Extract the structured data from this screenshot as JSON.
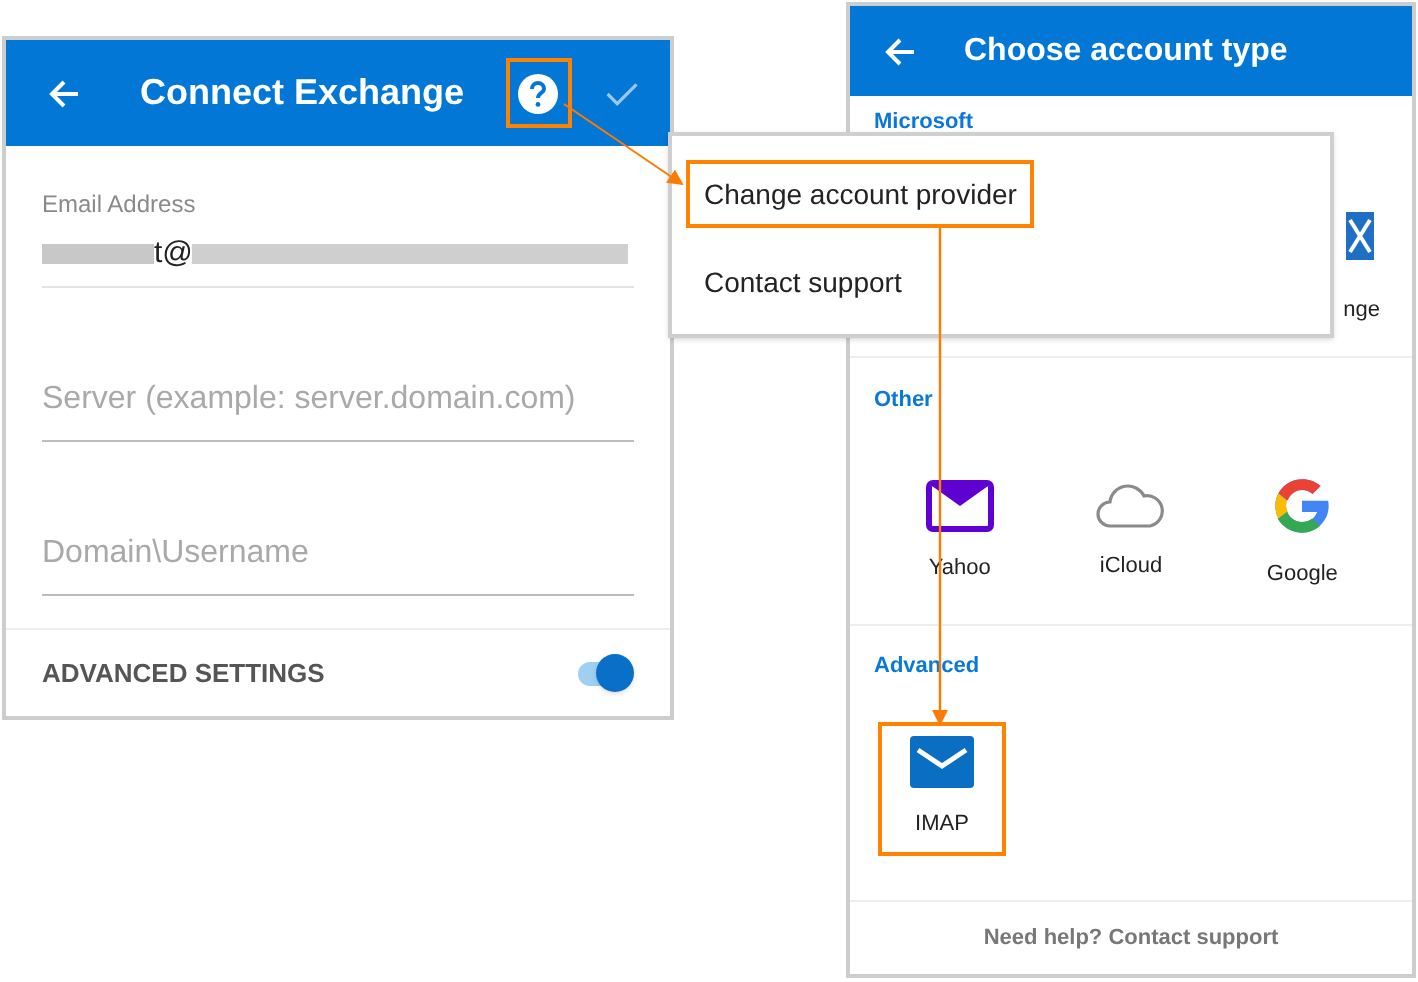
{
  "left_screen": {
    "title": "Connect Exchange",
    "help_highlighted": true,
    "fields": [
      {
        "kind": "value",
        "label": "Email Address",
        "value": "t@"
      },
      {
        "kind": "empty",
        "placeholder": "Server (example: server.domain.com)"
      },
      {
        "kind": "empty",
        "placeholder": "Domain\\Username"
      }
    ],
    "advanced_settings": {
      "label": "ADVANCED SETTINGS",
      "on": true
    }
  },
  "menu": {
    "items": [
      {
        "label": "Change account provider",
        "highlighted": true
      },
      {
        "label": "Contact support",
        "highlighted": false
      }
    ]
  },
  "right_screen": {
    "title": "Choose account type",
    "sections": [
      {
        "heading": "Microsoft",
        "items": [
          {
            "kind": "exchange",
            "label": "nge"
          }
        ]
      },
      {
        "heading": "Other",
        "items": [
          {
            "kind": "yahoo",
            "label": "Yahoo",
            "highlighted": false
          },
          {
            "kind": "icloud",
            "label": "iCloud",
            "highlighted": false
          },
          {
            "kind": "google",
            "label": "Google",
            "highlighted": false
          }
        ]
      },
      {
        "heading": "Advanced",
        "items": [
          {
            "kind": "imap",
            "label": "IMAP",
            "highlighted": true
          }
        ]
      }
    ],
    "footer": "Need help? Contact support"
  }
}
